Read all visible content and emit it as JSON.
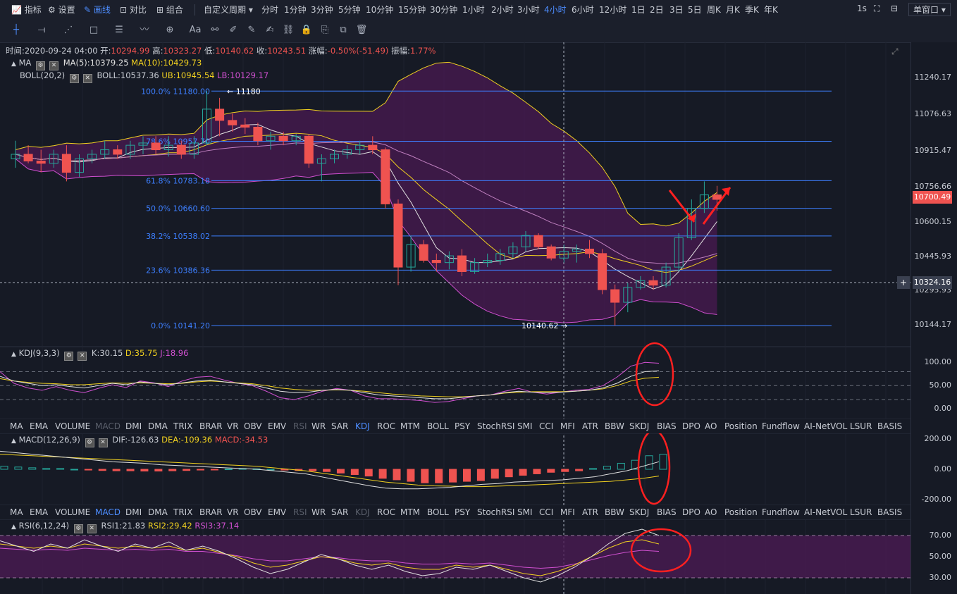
{
  "toolbar": {
    "indicators_label": "指标",
    "settings_label": "设置",
    "draw_label": "画线",
    "compare_label": "对比",
    "combo_label": "组合",
    "custom_period_label": "自定义周期",
    "timeframes": [
      "分时",
      "1分钟",
      "3分钟",
      "5分钟",
      "10分钟",
      "15分钟",
      "30分钟",
      "1小时",
      "2小时",
      "3小时",
      "4小时",
      "6小时",
      "12小时",
      "1日",
      "2日",
      "3日",
      "5日",
      "周K",
      "月K",
      "季K",
      "年K"
    ],
    "active_timeframe": "4小时",
    "refresh": "1s",
    "window_mode": "单窗口"
  },
  "info_bar": {
    "time_label": "时间:",
    "time": "2020-09-24 04:00",
    "open_label": "开:",
    "open": "10294.99",
    "high_label": "高:",
    "high": "10323.27",
    "low_label": "低:",
    "low": "10140.62",
    "close_label": "收:",
    "close": "10243.51",
    "change_label": "涨幅:",
    "change": "-0.50%(-51.49)",
    "amplitude_label": "振幅:",
    "amplitude": "1.77%"
  },
  "ma_legend": {
    "name": "MA",
    "ma5": "MA(5):10379.25",
    "ma10": "MA(10):10429.73"
  },
  "boll_legend": {
    "name": "BOLL(20,2)",
    "boll": "BOLL:10537.36",
    "ub": "UB:10945.54",
    "lb": "LB:10129.17"
  },
  "fib_levels": [
    {
      "label": "100.0% 11180.00",
      "price": 11180
    },
    {
      "label": "78.6% 10957.70",
      "price": 10957.7
    },
    {
      "label": "61.8% 10783.18",
      "price": 10783.18
    },
    {
      "label": "50.0% 10660.60",
      "price": 10660.6
    },
    {
      "label": "38.2% 10538.02",
      "price": 10538.02
    },
    {
      "label": "23.6% 10386.36",
      "price": 10386.36
    },
    {
      "label": "0.0% 10141.20",
      "price": 10141.2
    }
  ],
  "price_annotations": {
    "high_mark": "11180",
    "low_mark": "10140.62"
  },
  "price_axis": [
    "11240.17",
    "11076.63",
    "10915.47",
    "10756.66",
    "10600.15",
    "10445.93",
    "10295.93",
    "10144.17"
  ],
  "last_price_tag": "10700.49",
  "crosshair_price_tag": "10324.16",
  "kdj_legend": {
    "name": "KDJ(9,3,3)",
    "k": "K:30.15",
    "d": "D:35.75",
    "j": "J:18.96"
  },
  "kdj_axis": [
    "100.00",
    "50.00",
    "0.00"
  ],
  "macd_legend": {
    "name": "MACD(12,26,9)",
    "dif": "DIF:-126.63",
    "dea": "DEA:-109.36",
    "macd": "MACD:-34.53"
  },
  "macd_axis": [
    "200.00",
    "0.00",
    "-200.00"
  ],
  "rsi_legend": {
    "name": "RSI(6,12,24)",
    "rsi1": "RSI1:21.83",
    "rsi2": "RSI2:29.42",
    "rsi3": "RSI3:37.14"
  },
  "rsi_axis": [
    "70.00",
    "50.00",
    "30.00"
  ],
  "indicator_tabs": [
    "MA",
    "EMA",
    "VOLUME",
    "MACD",
    "DMI",
    "DMA",
    "TRIX",
    "BRAR",
    "VR",
    "OBV",
    "EMV",
    "RSI",
    "WR",
    "SAR",
    "KDJ",
    "ROC",
    "MTM",
    "BOLL",
    "PSY",
    "StochRSI",
    "SMI",
    "CCI",
    "MFI",
    "ATR",
    "BBW",
    "SKDJ",
    "BIAS",
    "DPO",
    "AO",
    "Position",
    "Fundflow",
    "AI-NetVOL",
    "LSUR",
    "BASIS"
  ],
  "colors": {
    "up": "#26a69a",
    "down": "#ef5350",
    "ma5": "#e0e0e0",
    "ma10": "#f0d020",
    "boll_fill": "#4a1a52",
    "fib": "#3d7fff",
    "accent": "#4d8dff",
    "annotation": "#ff2020"
  },
  "chart_data": {
    "type": "candlestick",
    "candles": [
      [
        10880,
        10960,
        10840,
        10900
      ],
      [
        10900,
        10940,
        10860,
        10870
      ],
      [
        10870,
        10920,
        10820,
        10860
      ],
      [
        10860,
        10920,
        10840,
        10900
      ],
      [
        10900,
        10940,
        10780,
        10820
      ],
      [
        10820,
        10900,
        10800,
        10880
      ],
      [
        10880,
        10920,
        10860,
        10900
      ],
      [
        10900,
        10960,
        10880,
        10920
      ],
      [
        10920,
        10940,
        10880,
        10900
      ],
      [
        10900,
        10960,
        10880,
        10940
      ],
      [
        10940,
        10980,
        10900,
        10950
      ],
      [
        10950,
        10980,
        10900,
        10920
      ],
      [
        10920,
        10980,
        10890,
        10940
      ],
      [
        10940,
        10960,
        10880,
        10900
      ],
      [
        10900,
        10980,
        10880,
        10950
      ],
      [
        10950,
        11180,
        10940,
        11100
      ],
      [
        11100,
        11150,
        10980,
        11050
      ],
      [
        11050,
        11080,
        11000,
        11030
      ],
      [
        11030,
        11060,
        10990,
        11020
      ],
      [
        11020,
        11040,
        10940,
        10960
      ],
      [
        10960,
        11000,
        10920,
        10980
      ],
      [
        10980,
        11000,
        10940,
        10960
      ],
      [
        10960,
        10990,
        10940,
        10980
      ],
      [
        10980,
        10990,
        10840,
        10860
      ],
      [
        10860,
        10900,
        10780,
        10880
      ],
      [
        10880,
        10920,
        10860,
        10900
      ],
      [
        10900,
        10940,
        10880,
        10920
      ],
      [
        10920,
        10960,
        10900,
        10940
      ],
      [
        10940,
        10980,
        10900,
        10920
      ],
      [
        10920,
        10930,
        10660,
        10680
      ],
      [
        10680,
        10700,
        10320,
        10400
      ],
      [
        10400,
        10540,
        10380,
        10500
      ],
      [
        10500,
        10520,
        10420,
        10430
      ],
      [
        10430,
        10460,
        10380,
        10420
      ],
      [
        10420,
        10470,
        10390,
        10450
      ],
      [
        10450,
        10480,
        10360,
        10380
      ],
      [
        10380,
        10440,
        10370,
        10420
      ],
      [
        10420,
        10460,
        10400,
        10430
      ],
      [
        10430,
        10480,
        10410,
        10460
      ],
      [
        10460,
        10510,
        10440,
        10490
      ],
      [
        10490,
        10560,
        10470,
        10540
      ],
      [
        10540,
        10550,
        10480,
        10490
      ],
      [
        10490,
        10500,
        10430,
        10440
      ],
      [
        10440,
        10500,
        10420,
        10470
      ],
      [
        10470,
        10500,
        10420,
        10480
      ],
      [
        10480,
        10520,
        10440,
        10460
      ],
      [
        10460,
        10480,
        10280,
        10300
      ],
      [
        10300,
        10323,
        10141,
        10244
      ],
      [
        10244,
        10330,
        10200,
        10310
      ],
      [
        10310,
        10360,
        10300,
        10340
      ],
      [
        10340,
        10360,
        10300,
        10320
      ],
      [
        10320,
        10420,
        10310,
        10400
      ],
      [
        10400,
        10550,
        10380,
        10530
      ],
      [
        10530,
        10700,
        10520,
        10660
      ],
      [
        10660,
        10780,
        10640,
        10720
      ],
      [
        10720,
        10760,
        10650,
        10700
      ]
    ],
    "y_range": [
      10100,
      11300
    ],
    "kdj": {
      "y_range": [
        -10,
        120
      ],
      "k": [
        70,
        60,
        55,
        50,
        52,
        48,
        45,
        50,
        55,
        52,
        58,
        55,
        52,
        56,
        60,
        62,
        58,
        55,
        52,
        45,
        38,
        35,
        36,
        40,
        42,
        40,
        35,
        30,
        28,
        26,
        24,
        22,
        22,
        25,
        28,
        30,
        35,
        38,
        36,
        35,
        36,
        38,
        40,
        45,
        55,
        70,
        80,
        82
      ],
      "d": [
        65,
        60,
        57,
        55,
        54,
        52,
        52,
        54,
        56,
        55,
        56,
        55,
        54,
        55,
        58,
        60,
        58,
        56,
        54,
        50,
        45,
        42,
        40,
        40,
        41,
        40,
        38,
        35,
        32,
        30,
        28,
        27,
        26,
        26,
        28,
        30,
        34,
        36,
        37,
        37,
        37,
        38,
        40,
        43,
        50,
        60,
        66,
        68
      ],
      "j": [
        80,
        55,
        45,
        40,
        48,
        40,
        35,
        44,
        52,
        46,
        60,
        56,
        48,
        60,
        68,
        70,
        62,
        55,
        50,
        38,
        24,
        20,
        28,
        38,
        44,
        40,
        28,
        22,
        22,
        20,
        18,
        14,
        16,
        22,
        28,
        30,
        38,
        44,
        36,
        32,
        36,
        40,
        42,
        50,
        68,
        92,
        100,
        98
      ]
    },
    "macd": {
      "y_range": [
        -220,
        220
      ],
      "hist": [
        20,
        15,
        10,
        5,
        5,
        0,
        -5,
        -8,
        -10,
        -10,
        -12,
        -12,
        -10,
        -8,
        -5,
        -3,
        2,
        5,
        3,
        0,
        -5,
        -8,
        -10,
        -15,
        -25,
        -35,
        -45,
        -60,
        -70,
        -80,
        -90,
        -90,
        -85,
        -80,
        -75,
        -60,
        -50,
        -40,
        -30,
        -20,
        -15,
        -10,
        5,
        20,
        40,
        60,
        90,
        100
      ],
      "dif": [
        120,
        110,
        100,
        90,
        80,
        70,
        60,
        50,
        45,
        40,
        30,
        25,
        20,
        15,
        10,
        5,
        0,
        -10,
        -20,
        -30,
        -50,
        -70,
        -90,
        -110,
        -125,
        -130,
        -130,
        -125,
        -120,
        -110,
        -100,
        -95,
        -85,
        -80,
        -75,
        -70,
        -60,
        -50,
        -30,
        -10,
        20,
        50
      ],
      "dea": [
        100,
        95,
        90,
        85,
        80,
        75,
        70,
        65,
        60,
        55,
        50,
        45,
        40,
        35,
        30,
        25,
        20,
        10,
        0,
        -10,
        -25,
        -40,
        -55,
        -70,
        -85,
        -95,
        -105,
        -110,
        -112,
        -115,
        -115,
        -112,
        -108,
        -104,
        -100,
        -95,
        -90,
        -85,
        -80,
        -70,
        -60,
        -45
      ]
    },
    "rsi": {
      "y_range": [
        20,
        80
      ],
      "rsi1": [
        65,
        60,
        55,
        62,
        58,
        66,
        60,
        55,
        62,
        58,
        64,
        56,
        60,
        55,
        48,
        40,
        34,
        38,
        45,
        52,
        48,
        42,
        38,
        42,
        36,
        32,
        34,
        40,
        38,
        42,
        36,
        30,
        26,
        32,
        40,
        50,
        62,
        72,
        76,
        70
      ],
      "rsi2": [
        62,
        60,
        58,
        60,
        58,
        62,
        60,
        58,
        60,
        58,
        60,
        56,
        58,
        54,
        50,
        44,
        40,
        42,
        46,
        50,
        48,
        44,
        42,
        44,
        40,
        38,
        38,
        42,
        40,
        42,
        38,
        34,
        32,
        36,
        42,
        50,
        58,
        64,
        66,
        62
      ],
      "rsi3": [
        58,
        57,
        56,
        57,
        56,
        58,
        57,
        56,
        57,
        56,
        57,
        55,
        55,
        53,
        51,
        48,
        46,
        46,
        48,
        50,
        49,
        47,
        46,
        46,
        44,
        43,
        43,
        44,
        43,
        44,
        42,
        40,
        39,
        40,
        43,
        47,
        51,
        54,
        56,
        55
      ]
    }
  }
}
